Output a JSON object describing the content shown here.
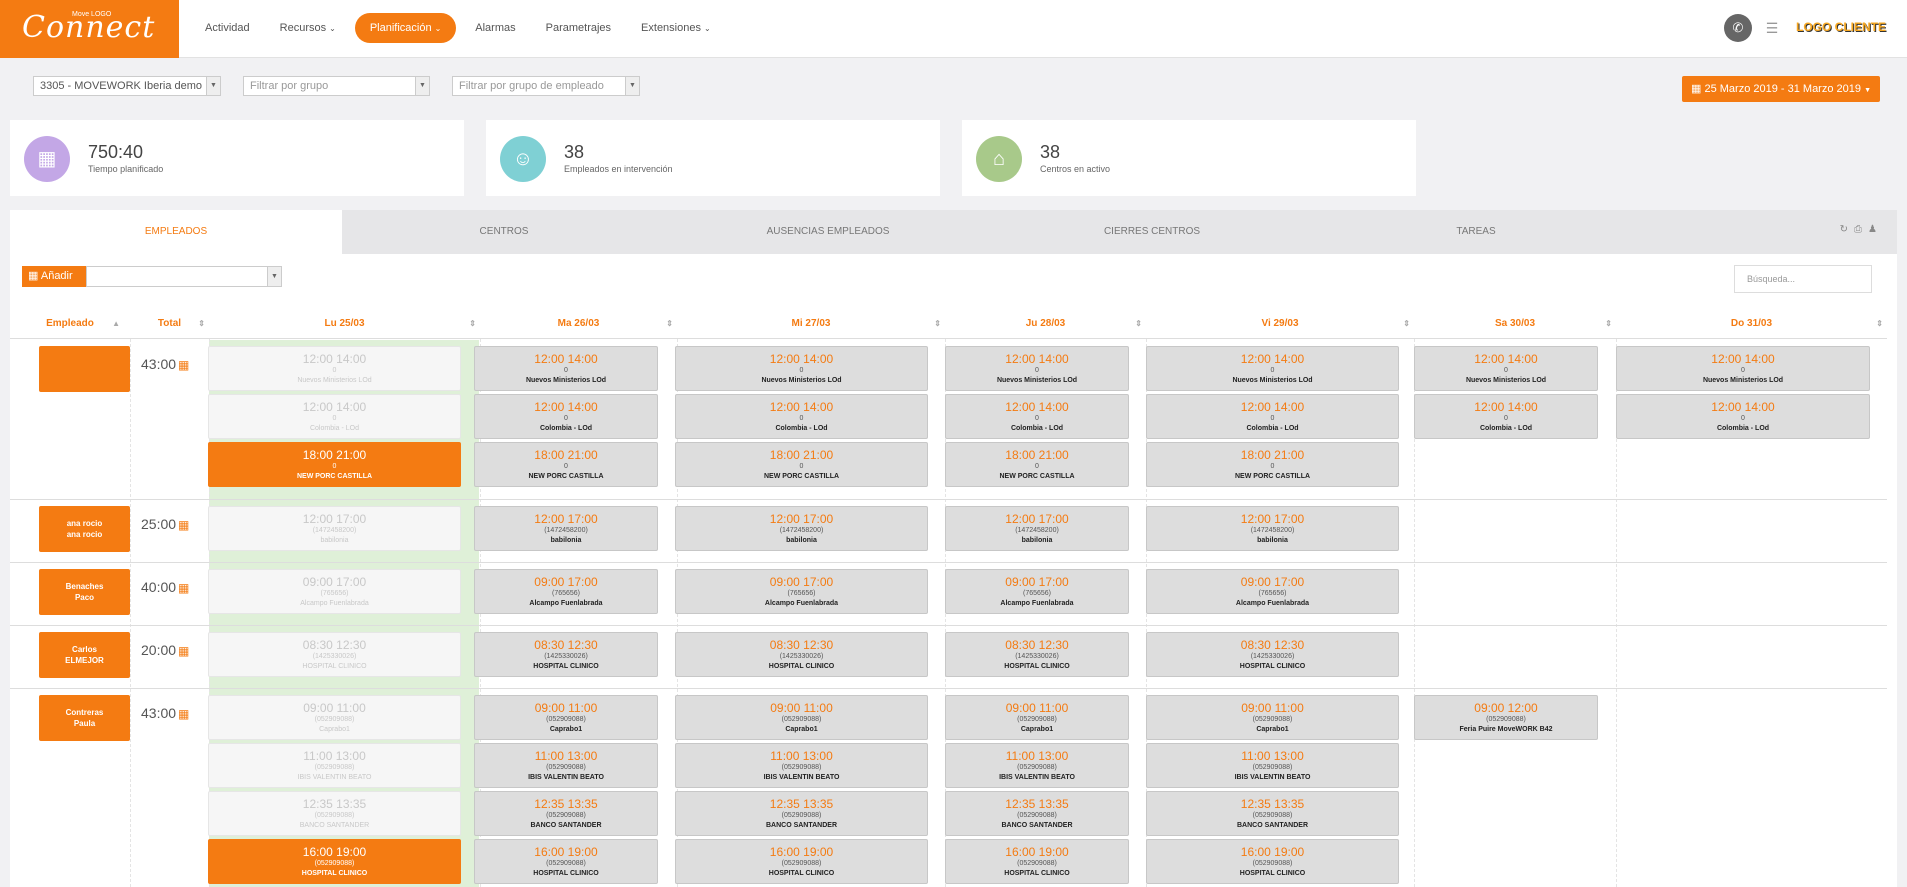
{
  "header": {
    "logo_text": "Connect",
    "logo_small": "Move LOGO",
    "nav": [
      {
        "label": "Actividad",
        "has_menu": false
      },
      {
        "label": "Recursos",
        "has_menu": true
      },
      {
        "label": "Planificación",
        "has_menu": true,
        "active": true
      },
      {
        "label": "Alarmas",
        "has_menu": false
      },
      {
        "label": "Parametrajes",
        "has_menu": false
      },
      {
        "label": "Extensiones",
        "has_menu": true
      }
    ],
    "brand": "LOGO CLIENTE"
  },
  "filters": {
    "company": "3305 - MOVEWORK Iberia demo",
    "group_placeholder": "Filtrar por grupo",
    "employee_group_placeholder": "Filtrar por grupo de empleado",
    "date_range": "25 Marzo 2019 - 31 Marzo 2019"
  },
  "stats": [
    {
      "value": "750:40",
      "label": "Tiempo planificado",
      "color": "#c3a7e6",
      "icon": "calendar-icon"
    },
    {
      "value": "38",
      "label": "Empleados en intervención",
      "color": "#7fd0d4",
      "icon": "users-icon"
    },
    {
      "value": "38",
      "label": "Centros en activo",
      "color": "#a8c98a",
      "icon": "home-icon"
    }
  ],
  "tabs": [
    "EMPLEADOS",
    "CENTROS",
    "AUSENCIAS EMPLEADOS",
    "CIERRES CENTROS",
    "TAREAS"
  ],
  "toolbar": {
    "add_label": "Añadir",
    "search_placeholder": "Búsqueda..."
  },
  "columns": {
    "employee": "Empleado",
    "total": "Total",
    "days": [
      "Lu 25/03",
      "Ma 26/03",
      "Mi 27/03",
      "Ju 28/03",
      "Vi 29/03",
      "Sa 30/03",
      "Do 31/03"
    ]
  },
  "accent_color": "#f47b12",
  "rows": [
    {
      "name": [
        "",
        ""
      ],
      "total": "43:00",
      "shifts": [
        {
          "time": "12:00 14:00",
          "code": "0",
          "center": "Nuevos Ministerios LOd",
          "days": [
            0,
            1,
            2,
            3,
            4,
            5,
            6
          ]
        },
        {
          "time": "12:00 14:00",
          "code": "0",
          "center": "Colombia - LOd",
          "days": [
            0,
            1,
            2,
            3,
            4,
            5,
            6
          ]
        },
        {
          "time": "18:00 21:00",
          "code": "0",
          "center": "NEW PORC CASTILLA",
          "days": [
            0,
            1,
            2,
            3,
            4
          ],
          "current_day0": true
        }
      ]
    },
    {
      "name": [
        "ana rocio",
        "ana rocio"
      ],
      "total": "25:00",
      "shifts": [
        {
          "time": "12:00 17:00",
          "code": "(1472458200)",
          "center": "babilonia",
          "days": [
            0,
            1,
            2,
            3,
            4
          ]
        }
      ]
    },
    {
      "name": [
        "Benaches",
        "Paco"
      ],
      "total": "40:00",
      "shifts": [
        {
          "time": "09:00 17:00",
          "code": "(765656)",
          "center": "Alcampo Fuenlabrada",
          "days": [
            0,
            1,
            2,
            3,
            4
          ]
        }
      ]
    },
    {
      "name": [
        "Carlos",
        "ELMEJOR"
      ],
      "total": "20:00",
      "shifts": [
        {
          "time": "08:30 12:30",
          "code": "(1425330026)",
          "center": "HOSPITAL CLINICO",
          "days": [
            0,
            1,
            2,
            3,
            4
          ]
        }
      ]
    },
    {
      "name": [
        "Contreras",
        "Paula"
      ],
      "total": "43:00",
      "shifts": [
        {
          "time": "09:00 11:00",
          "code": "(052909088)",
          "center": "Caprabo1",
          "days": [
            0,
            1,
            2,
            3,
            4
          ]
        },
        {
          "time": "11:00 13:00",
          "code": "(052909088)",
          "center": "IBIS VALENTIN BEATO",
          "days": [
            0,
            1,
            2,
            3,
            4
          ]
        },
        {
          "time": "12:35 13:35",
          "code": "(052909088)",
          "center": "BANCO SANTANDER",
          "days": [
            0,
            1,
            2,
            3,
            4
          ]
        },
        {
          "time": "16:00 19:00",
          "code": "(052909088)",
          "center": "HOSPITAL CLINICO",
          "days": [
            0,
            1,
            2,
            3,
            4
          ],
          "current_day0": true
        }
      ],
      "extra": {
        "day": 5,
        "time": "09:00 12:00",
        "code": "(052909088)",
        "center": "Feria Puire MoveWORK B42"
      }
    }
  ]
}
